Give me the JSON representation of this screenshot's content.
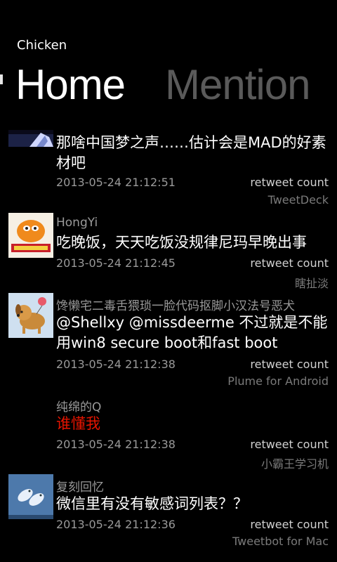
{
  "app": {
    "title": "Chicken"
  },
  "pivot": {
    "tabs": [
      "Home",
      "Mention"
    ]
  },
  "tweets": [
    {
      "author": "",
      "text": "那啥中国梦之声……估计会是MAD的好素材吧",
      "date": "2013-05-24  21:12:51",
      "retweet": "retweet count",
      "source": "TweetDeck"
    },
    {
      "author": "HongYi",
      "text": "吃晚饭，天天吃饭没规律尼玛早晚出事",
      "date": "2013-05-24  21:12:45",
      "retweet": "retweet count",
      "source": "瞎扯淡"
    },
    {
      "author": "馋懒宅二毒舌猥琐一脸代码抠脚小汉法号恶犬",
      "text": "@Shellxy @missdeerme 不过就是不能用win8 secure boot和fast boot",
      "date": "2013-05-24  21:12:38",
      "retweet": "retweet count",
      "source": "Plume for Android"
    },
    {
      "author": "纯绵的Q",
      "text": "谁懂我",
      "date": "2013-05-24  21:12:38",
      "retweet": "retweet count",
      "source": "小霸王学习机"
    },
    {
      "author": "复刻回忆",
      "text": "微信里有没有敏感词列表？？",
      "date": "2013-05-24  21:12:36",
      "retweet": "retweet count",
      "source": "Tweetbot for Mac"
    }
  ]
}
